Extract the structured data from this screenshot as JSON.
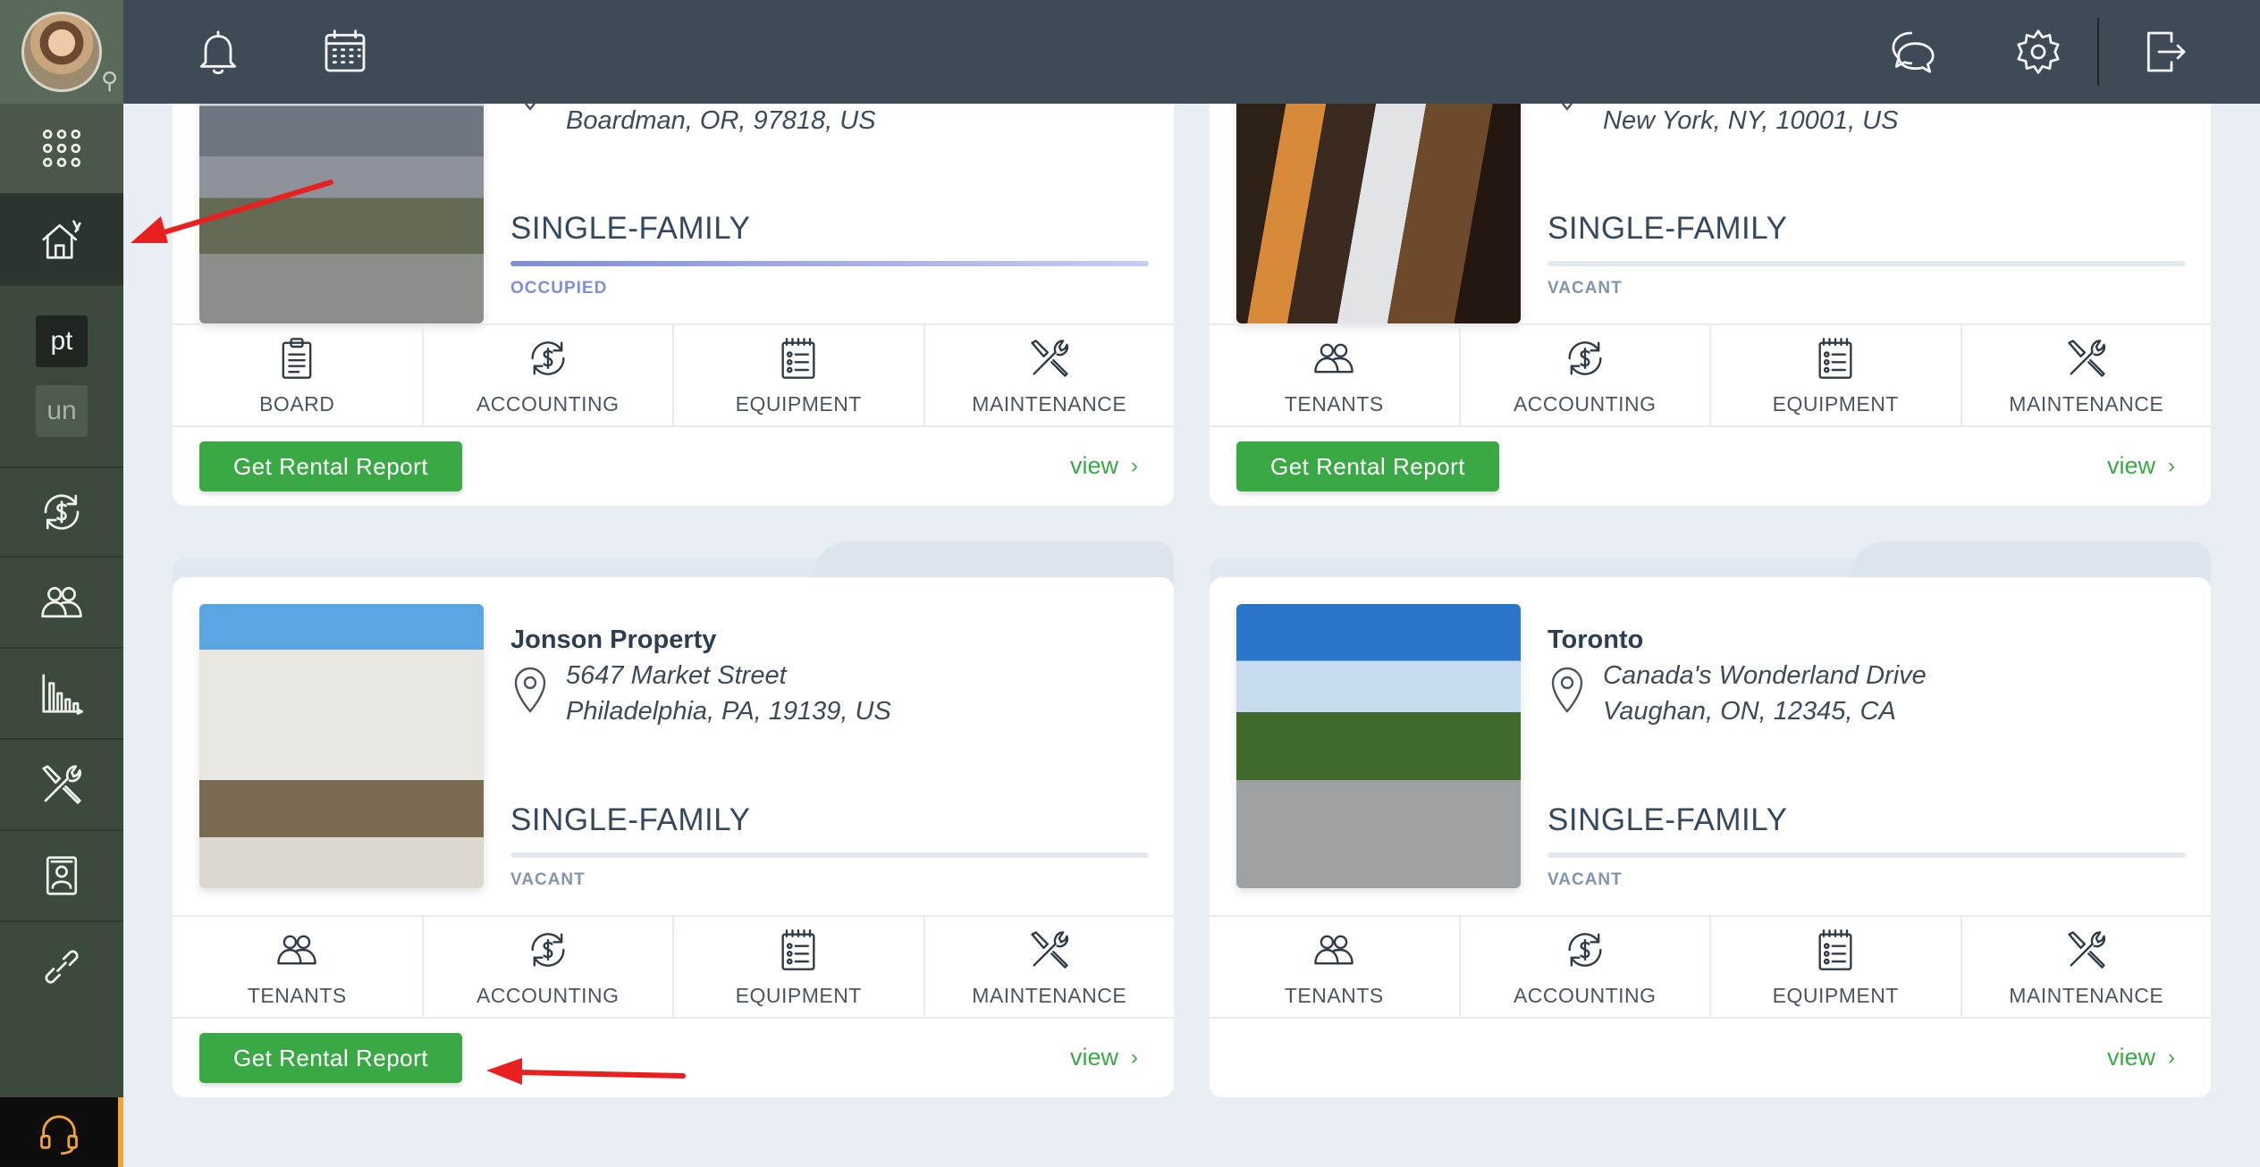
{
  "sidebar": {
    "badges": {
      "pt": "pt",
      "un": "un"
    }
  },
  "cards": [
    {
      "name": "",
      "address_line1": "",
      "address_line2": "Boardman, OR, 97818, US",
      "type": "SINGLE-FAMILY",
      "status": "OCCUPIED",
      "occupancy": 1.0,
      "menu": [
        "BOARD",
        "ACCOUNTING",
        "EQUIPMENT",
        "MAINTENANCE"
      ],
      "report_label": "Get Rental Report",
      "view_label": "view",
      "chev": "›"
    },
    {
      "name": "",
      "address_line1": "",
      "address_line2": "New York, NY, 10001, US",
      "type": "SINGLE-FAMILY",
      "status": "VACANT",
      "occupancy": 0.0,
      "menu": [
        "TENANTS",
        "ACCOUNTING",
        "EQUIPMENT",
        "MAINTENANCE"
      ],
      "report_label": "Get Rental Report",
      "view_label": "view",
      "chev": "›"
    },
    {
      "name": "Jonson Property",
      "address_line1": "5647 Market Street",
      "address_line2": "Philadelphia, PA, 19139, US",
      "type": "SINGLE-FAMILY",
      "status": "VACANT",
      "occupancy": 0.0,
      "menu": [
        "TENANTS",
        "ACCOUNTING",
        "EQUIPMENT",
        "MAINTENANCE"
      ],
      "report_label": "Get Rental Report",
      "view_label": "view",
      "chev": "›"
    },
    {
      "name": "Toronto",
      "address_line1": "Canada's Wonderland Drive",
      "address_line2": "Vaughan, ON, 12345, CA",
      "type": "SINGLE-FAMILY",
      "status": "VACANT",
      "occupancy": 0.0,
      "menu": [
        "TENANTS",
        "ACCOUNTING",
        "EQUIPMENT",
        "MAINTENANCE"
      ],
      "report_label": "",
      "view_label": "view",
      "chev": "›"
    }
  ],
  "colors": {
    "sidebar": "#3b4a3c",
    "topbar": "#3e4a56",
    "accent_green": "#3aa845",
    "occupied": "#7f8fd6",
    "annotation_red": "#e8201f",
    "support_accent": "#f1a33a"
  },
  "icons": {
    "topbar": [
      "bell-icon",
      "calendar-icon",
      "chat-icon",
      "gear-icon",
      "logout-icon"
    ],
    "sidebar": [
      "apps-grid-icon",
      "home-icon",
      "accounting-icon",
      "tenants-icon",
      "reports-icon",
      "maintenance-icon",
      "document-icon",
      "link-icon",
      "headset-icon"
    ]
  }
}
